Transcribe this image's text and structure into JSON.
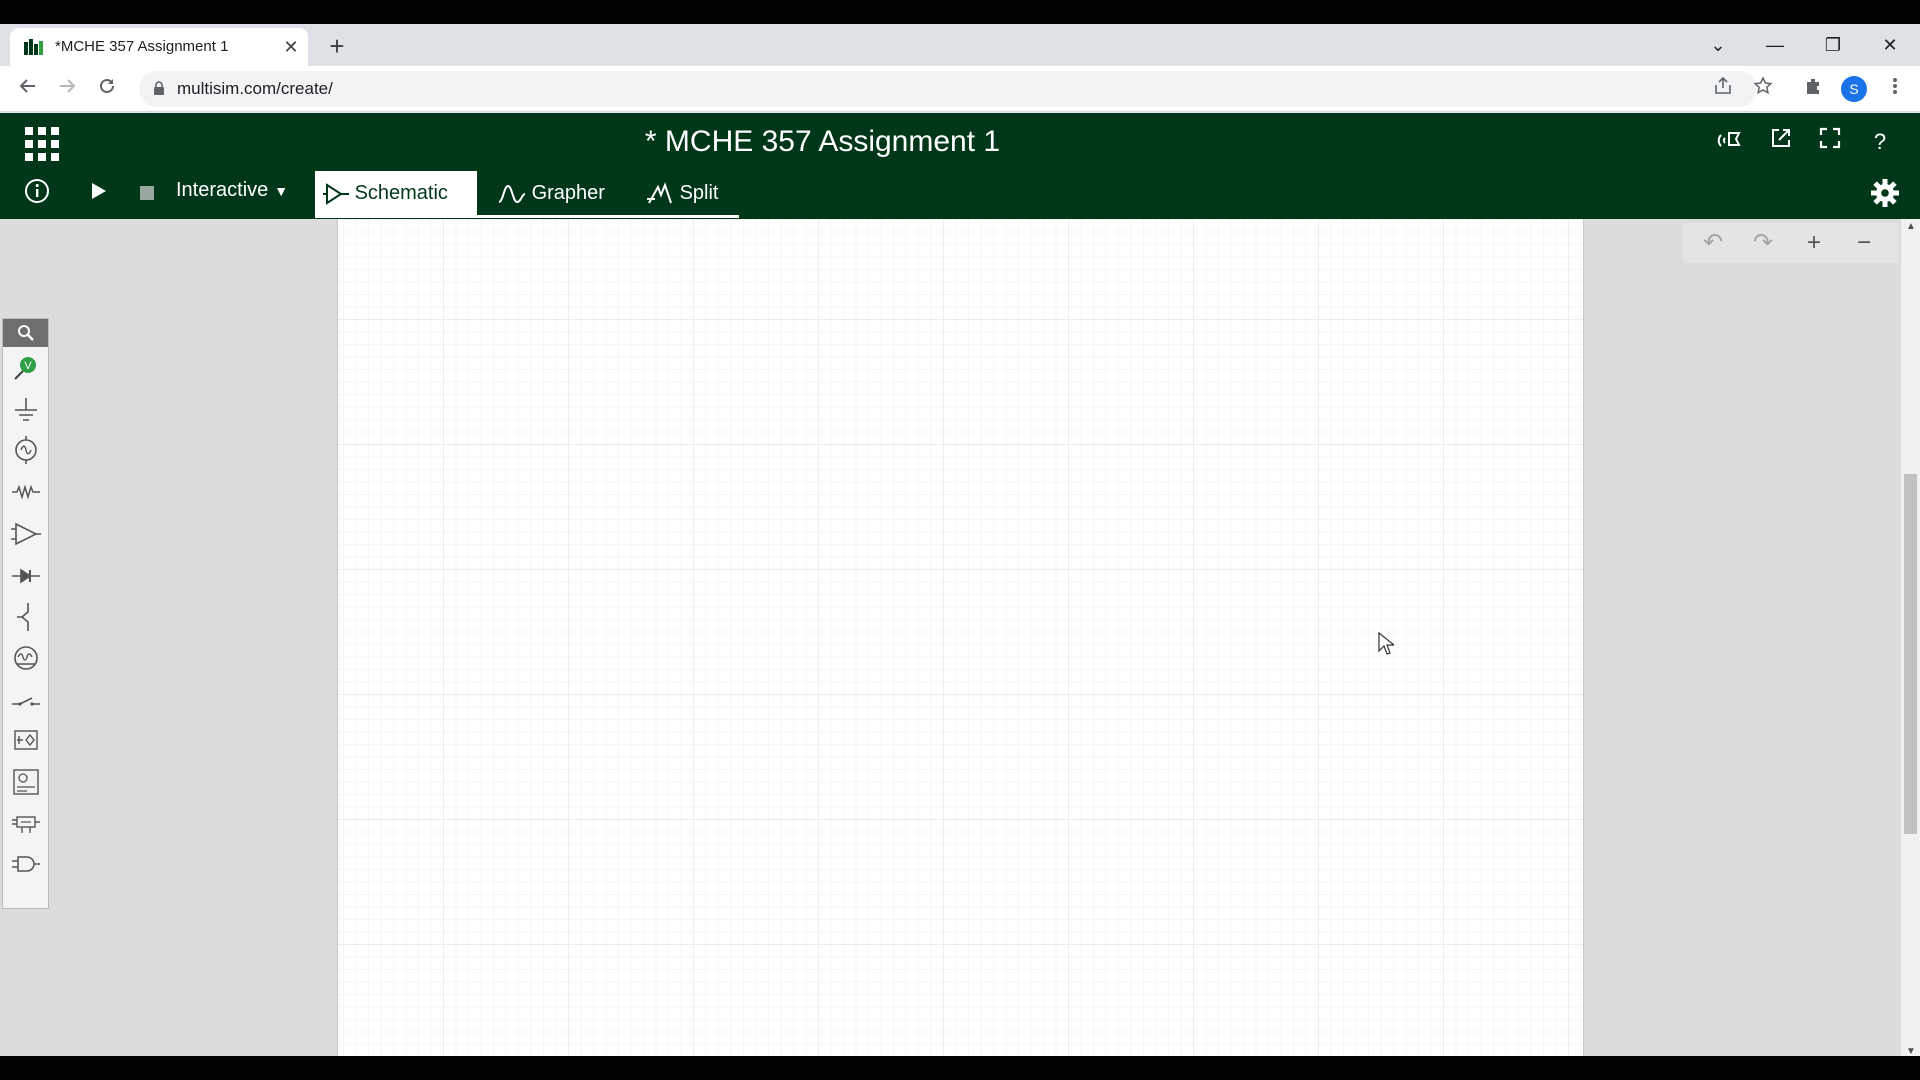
{
  "browser": {
    "tab_title": "*MCHE 357 Assignment 1",
    "tab_close": "✕",
    "new_tab": "+",
    "url": "multisim.com/create/",
    "profile_initial": "S",
    "icons": [
      "back-icon",
      "forward-icon",
      "reload-icon",
      "lock-icon",
      "share-icon",
      "star-icon",
      "extensions-icon",
      "profile-avatar",
      "menu-icon"
    ]
  },
  "window_controls": {
    "tab_list": "⌄",
    "minimize": "—",
    "restore": "❐",
    "close": "✕"
  },
  "app": {
    "title": "* MCHE 357 Assignment 1",
    "brand_color": "#003719",
    "mode_label": "Interactive",
    "tabs": [
      {
        "label": "Schematic",
        "active": true
      },
      {
        "label": "Grapher",
        "active": false
      },
      {
        "label": "Split",
        "active": false
      }
    ],
    "header_icons": [
      "apps-grid-icon",
      "feedback-icon",
      "export-icon",
      "fullscreen-icon",
      "help-icon"
    ],
    "help": "?"
  },
  "palette": {
    "items": [
      "search-icon",
      "probe-icon",
      "ground-icon",
      "source-icon",
      "resistor-icon",
      "amplifier-icon",
      "diode-icon",
      "transistor-icon",
      "meter-icon",
      "switch-icon",
      "controlled-source-icon",
      "analog-block-icon",
      "digital-block-icon",
      "logic-gate-icon"
    ],
    "probe_badge": "V"
  },
  "view_controls": {
    "undo": "↶",
    "redo": "↷",
    "zoom_in": "+",
    "zoom_out": "−"
  }
}
